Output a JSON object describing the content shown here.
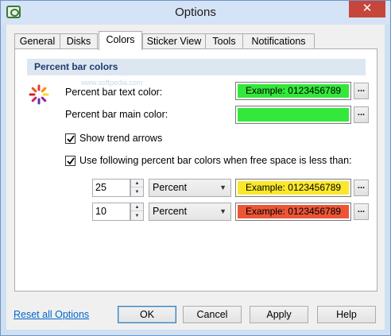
{
  "window": {
    "title": "Options",
    "close_glyph": "✕"
  },
  "tabs": [
    {
      "label": "General"
    },
    {
      "label": "Disks"
    },
    {
      "label": "Colors"
    },
    {
      "label": "Sticker View"
    },
    {
      "label": "Tools"
    },
    {
      "label": "Notifications"
    }
  ],
  "active_tab": "Colors",
  "section": {
    "header": "Percent bar colors",
    "watermark": "www.softpedia.com"
  },
  "text_color": {
    "label": "Percent bar text color:",
    "example": "Example: 0123456789",
    "swatch_color": "#33e83a",
    "button": "..."
  },
  "main_color": {
    "label": "Percent bar main color:",
    "swatch_color": "#33e83a",
    "button": "..."
  },
  "show_trend": {
    "label": "Show trend arrows",
    "checked": true
  },
  "use_following": {
    "label": "Use following percent bar colors when free space is less than:",
    "checked": true
  },
  "thresholds": [
    {
      "value": "25",
      "unit": "Percent",
      "example": "Example: 0123456789",
      "swatch_color": "#fbe82b",
      "button": "..."
    },
    {
      "value": "10",
      "unit": "Percent",
      "example": "Example: 0123456789",
      "swatch_color": "#ec5637",
      "button": "..."
    }
  ],
  "footer": {
    "reset_link": "Reset all Options",
    "ok": "OK",
    "cancel": "Cancel",
    "apply": "Apply",
    "help": "Help"
  }
}
